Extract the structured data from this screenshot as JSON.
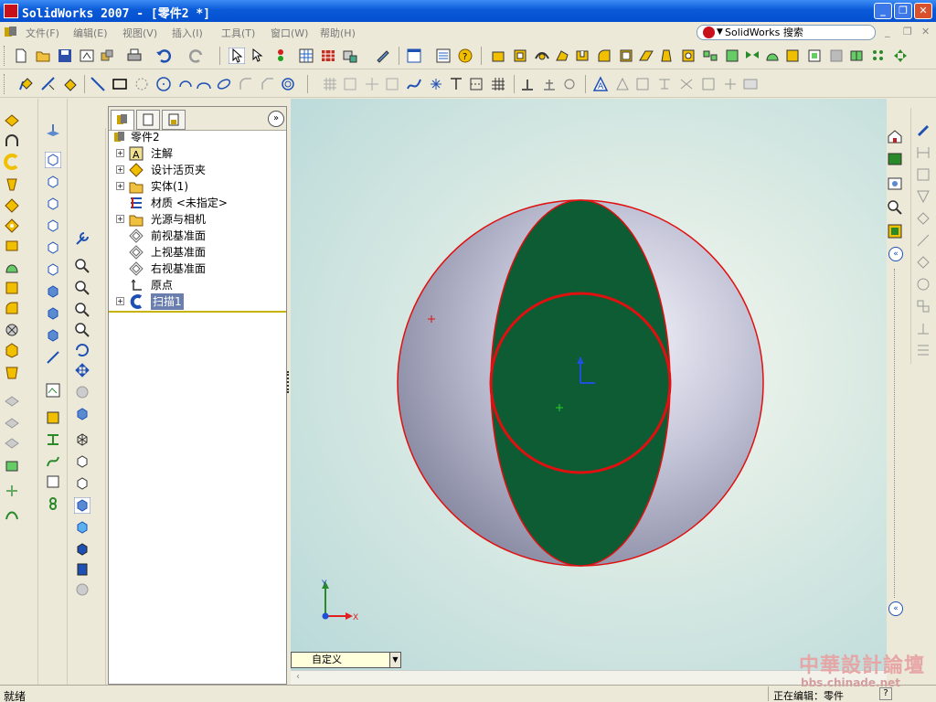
{
  "window": {
    "title": "SolidWorks 2007 - [零件2 *]",
    "min_label": "_",
    "max_label": "❐",
    "close_label": "✕"
  },
  "menu": {
    "items": [
      "文件(F)",
      "编辑(E)",
      "视图(V)",
      "插入(I)",
      "工具(T)",
      "窗口(W)",
      "帮助(H)"
    ],
    "mdi_controls": [
      "_",
      "❐",
      "✕"
    ]
  },
  "search": {
    "label": "SolidWorks 搜索"
  },
  "tree": {
    "items": [
      {
        "label": "零件2",
        "expander": false,
        "icon": "part-icon"
      },
      {
        "label": "注解",
        "expander": true,
        "icon": "annotations-icon"
      },
      {
        "label": "设计活页夹",
        "expander": true,
        "icon": "design-binder-icon"
      },
      {
        "label": "实体(1)",
        "expander": true,
        "icon": "solid-bodies-icon"
      },
      {
        "label": "材质 <未指定>",
        "expander": false,
        "icon": "material-icon"
      },
      {
        "label": "光源与相机",
        "expander": true,
        "icon": "lights-cameras-icon"
      },
      {
        "label": "前视基准面",
        "expander": false,
        "icon": "plane-icon"
      },
      {
        "label": "上视基准面",
        "expander": false,
        "icon": "plane-icon"
      },
      {
        "label": "右视基准面",
        "expander": false,
        "icon": "plane-icon"
      },
      {
        "label": "原点",
        "expander": false,
        "icon": "origin-icon"
      },
      {
        "label": "扫描1",
        "expander": true,
        "icon": "sweep-feature-icon"
      }
    ]
  },
  "viewport": {
    "triad": {
      "x_label": "X",
      "y_label": "Y"
    },
    "view_orientation": "自定义",
    "colors": {
      "sphere": "#a8aac4",
      "selected_face": "#0d5c33",
      "edge_highlight": "#e01010"
    }
  },
  "status": {
    "left": "就绪",
    "right": "正在编辑：零件",
    "help": "?"
  },
  "watermark": {
    "title": "中華設計論壇",
    "url": "bbs.chinade.net"
  }
}
